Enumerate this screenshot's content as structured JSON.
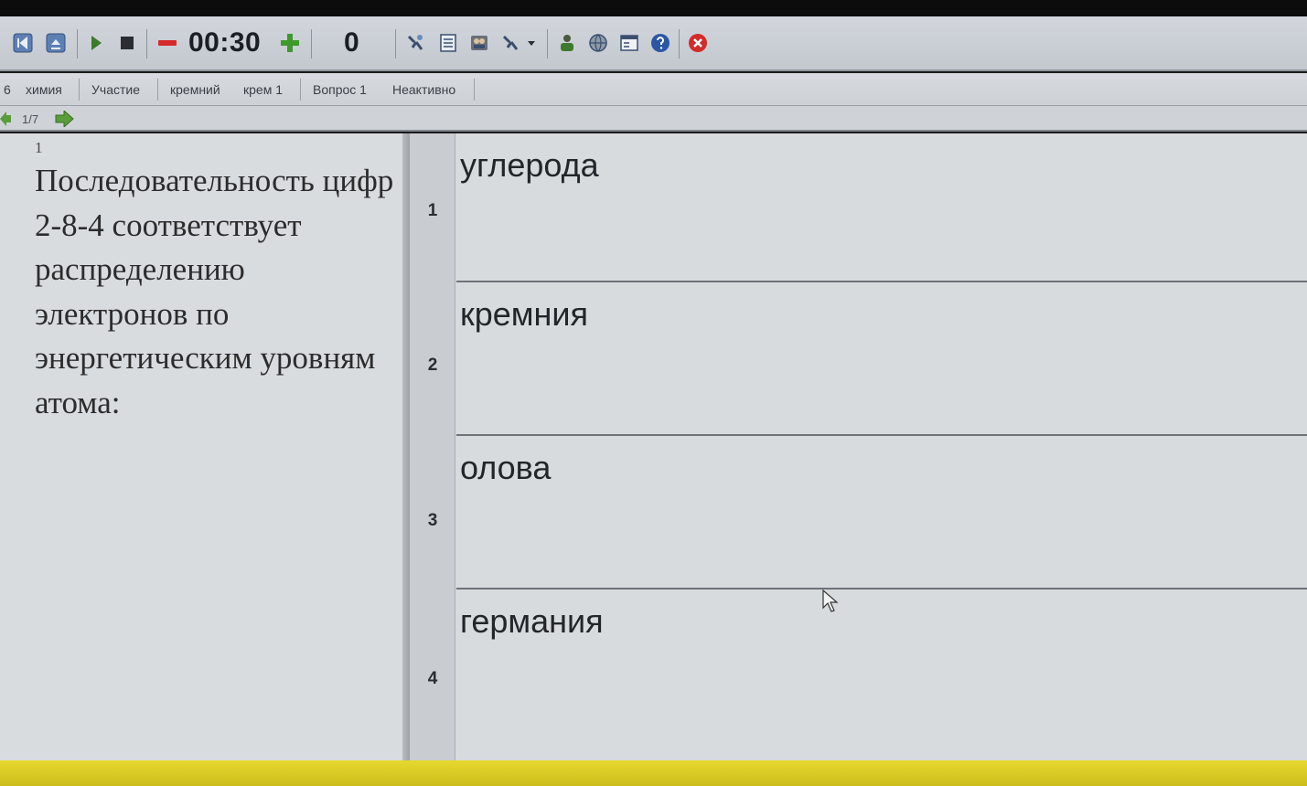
{
  "toolbar": {
    "timer": "00:30",
    "score": "0",
    "icons": [
      "first-page-icon",
      "page-up-icon",
      "play-icon",
      "stop-icon",
      "minus-icon",
      "plus-icon",
      "tool-icon",
      "document-icon",
      "users-icon",
      "tool-dropdown-icon",
      "person-icon",
      "globe-icon",
      "window-icon",
      "help-icon",
      "close-icon"
    ],
    "accent_red": "#d42a2a",
    "accent_green": "#3d9a2a"
  },
  "infobar": {
    "group": "6",
    "subject": "химия",
    "mode": "Участие",
    "topic": "кремний",
    "test": "крем 1",
    "question": "Вопрос 1",
    "status": "Неактивно"
  },
  "navbar": {
    "page": "1/7"
  },
  "question": {
    "number": "1",
    "text": "Последовательность цифр 2-8-4 соответствует распределению электронов по энергетическим уровням атома:"
  },
  "answers": [
    {
      "number": "1",
      "text": "углерода"
    },
    {
      "number": "2",
      "text": "кремния"
    },
    {
      "number": "3",
      "text": "олова"
    },
    {
      "number": "4",
      "text": "германия"
    }
  ]
}
